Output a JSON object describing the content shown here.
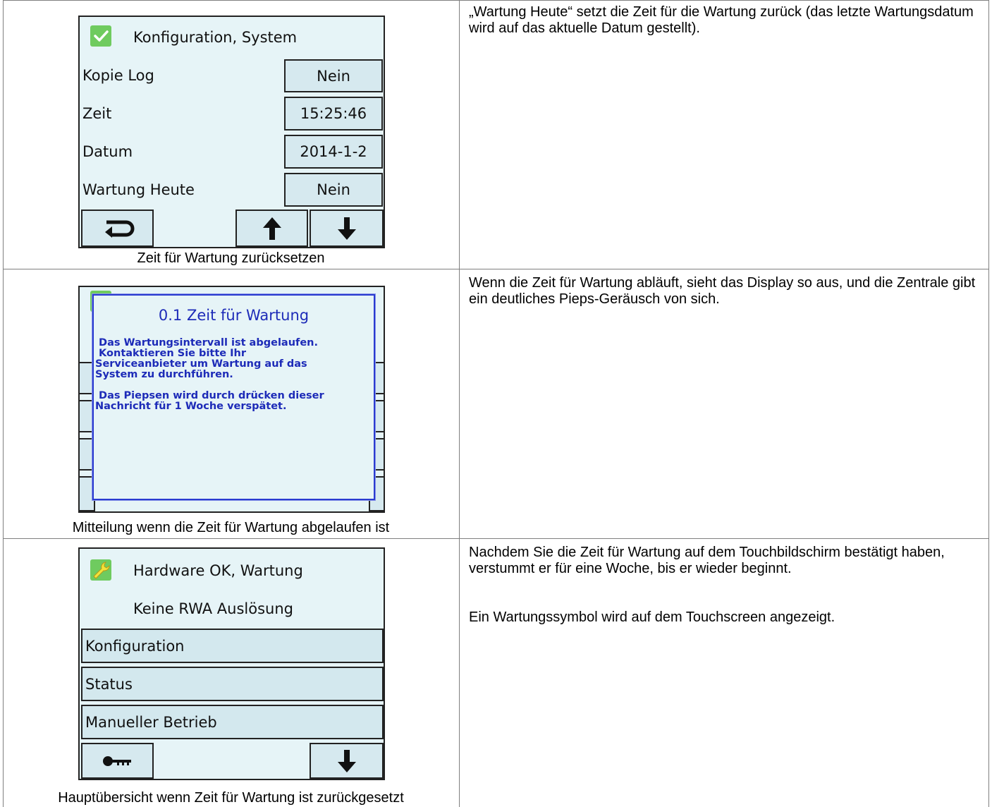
{
  "rows": [
    {
      "caption": "Zeit für Wartung zurücksetzen",
      "description": "„Wartung Heute“ setzt die Zeit für die Wartung zurück (das letzte Wartungsdatum wird auf das aktuelle Datum gestellt).",
      "screen": {
        "title": "Konfiguration, System",
        "items": [
          {
            "label": "Kopie Log",
            "value": "Nein"
          },
          {
            "label": "Zeit",
            "value": "15:25:46"
          },
          {
            "label": "Datum",
            "value": "2014-1-2"
          },
          {
            "label": "Wartung Heute",
            "value": "Nein"
          }
        ]
      }
    },
    {
      "caption": "Mitteilung wenn die Zeit für Wartung abgelaufen ist",
      "description": "Wenn die Zeit für Wartung abläuft, sieht das Display so aus, und die Zentrale gibt ein deutliches Pieps-Geräusch von sich.",
      "popup": {
        "title": "0.1 Zeit für Wartung",
        "line1": " Das Wartungsintervall ist abgelaufen.",
        "line2": " Kontaktieren Sie bitte Ihr",
        "line3": "Serviceanbieter um Wartung auf das",
        "line4": "System zu durchführen.",
        "line5": " Das Piepsen wird durch drücken dieser",
        "line6": "Nachricht für 1 Woche verspätet."
      }
    },
    {
      "caption": "Hauptübersicht wenn Zeit für Wartung ist zurückgesetzt",
      "description_p1": "Nachdem Sie die Zeit für Wartung auf dem Touchbildschirm bestätigt haben, verstummt er für eine Woche, bis er wieder beginnt.",
      "description_p2": "Ein Wartungssymbol wird auf dem Touchscreen angezeigt.",
      "screen": {
        "title": "Hardware OK, Wartung",
        "subtitle": "Keine RWA Auslösung",
        "menu": [
          "Konfiguration",
          "Status",
          "Manueller Betrieb"
        ]
      }
    }
  ],
  "colors": {
    "screen_bg": "#e6f4f7",
    "button_bg": "#d6e9ef",
    "popup_text": "#1d2bb8",
    "icon_green": "#6fcb5f"
  }
}
